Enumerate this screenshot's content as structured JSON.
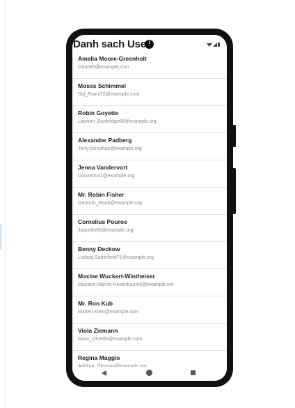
{
  "app": {
    "title": "Danh sach User"
  },
  "users": [
    {
      "name": "Amelia Moore-Greenholt",
      "email": "Orion85@example.com"
    },
    {
      "name": "Moses Schimmel",
      "email": "Sid_Frami72@example.com"
    },
    {
      "name": "Robin Goyette",
      "email": "Lawson_Buckridge68@example.org"
    },
    {
      "name": "Alexander Padberg",
      "email": "Terry.Monahan@example.org"
    },
    {
      "name": "Jenna Vandervort",
      "email": "Donavon42@example.org"
    },
    {
      "name": "Mr. Robin Fisher",
      "email": "Gerardo_Roob@example.org"
    },
    {
      "name": "Cornelius Pouros",
      "email": "Jaquelin60@example.org"
    },
    {
      "name": "Benny Deckow",
      "email": "Ludwig.Satterfield71@example.org"
    },
    {
      "name": "Maxine Wuckert-Wintheiser",
      "email": "Mariano.Marvin-Rosenbaum0@example.net"
    },
    {
      "name": "Mr. Ron Kub",
      "email": "Marlen.Klein@example.com"
    },
    {
      "name": "Viola Ziemann",
      "email": "Mara_OKeefe@example.com"
    },
    {
      "name": "Regina Maggio",
      "email": "Adelina_Gleason@example.org"
    }
  ],
  "icons": {
    "status": [
      "wifi-icon",
      "signal-icon",
      "battery-icon"
    ],
    "nav": [
      "back-icon",
      "home-icon",
      "recents-icon"
    ]
  }
}
